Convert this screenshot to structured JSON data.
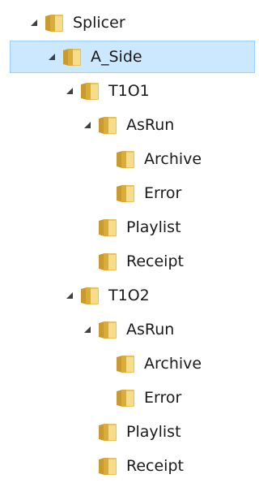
{
  "tree": {
    "nodes": [
      {
        "label": "Splicer",
        "level": 0,
        "expanded": true,
        "selected": false
      },
      {
        "label": "A_Side",
        "level": 1,
        "expanded": true,
        "selected": true
      },
      {
        "label": "T1O1",
        "level": 2,
        "expanded": true,
        "selected": false
      },
      {
        "label": "AsRun",
        "level": 3,
        "expanded": true,
        "selected": false
      },
      {
        "label": "Archive",
        "level": 4,
        "expanded": false,
        "selected": false
      },
      {
        "label": "Error",
        "level": 4,
        "expanded": false,
        "selected": false
      },
      {
        "label": "Playlist",
        "level": 3,
        "expanded": false,
        "selected": false
      },
      {
        "label": "Receipt",
        "level": 3,
        "expanded": false,
        "selected": false
      },
      {
        "label": "T1O2",
        "level": 2,
        "expanded": true,
        "selected": false
      },
      {
        "label": "AsRun",
        "level": 3,
        "expanded": true,
        "selected": false
      },
      {
        "label": "Archive",
        "level": 4,
        "expanded": false,
        "selected": false
      },
      {
        "label": "Error",
        "level": 4,
        "expanded": false,
        "selected": false
      },
      {
        "label": "Playlist",
        "level": 3,
        "expanded": false,
        "selected": false
      },
      {
        "label": "Receipt",
        "level": 3,
        "expanded": false,
        "selected": false
      }
    ]
  },
  "colors": {
    "selection_fill": "#cce8ff",
    "selection_border": "#99d1ff",
    "folder_yellow": "#e8c25a",
    "folder_light": "#f7dc8c",
    "expander_arrow": "#404040"
  },
  "icons": {
    "folder": "folder-icon",
    "expander": "expanded-arrow-icon"
  }
}
